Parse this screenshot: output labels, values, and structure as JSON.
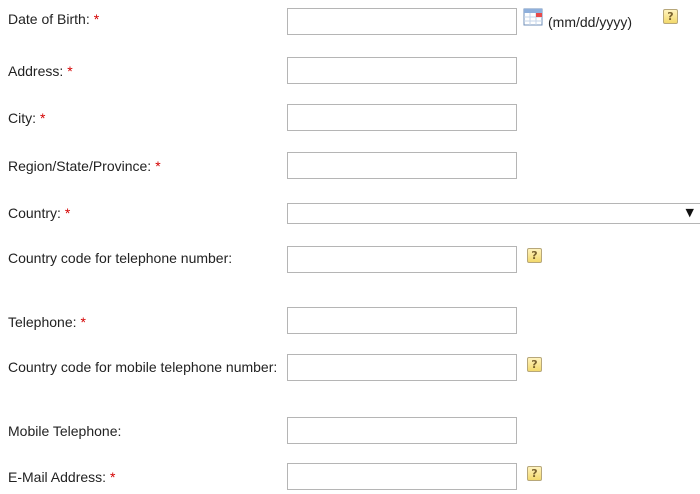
{
  "form": {
    "dob": {
      "label": "Date of Birth:",
      "required_mark": "*",
      "value": "",
      "format_hint": "(mm/dd/yyyy)",
      "help_icon": "?"
    },
    "address": {
      "label": "Address:",
      "required_mark": "*",
      "value": ""
    },
    "city": {
      "label": "City:",
      "required_mark": "*",
      "value": ""
    },
    "region": {
      "label": "Region/State/Province:",
      "required_mark": "*",
      "value": ""
    },
    "country": {
      "label": "Country:",
      "required_mark": "*",
      "selected_value": "",
      "arrow": "▼"
    },
    "country_code_tel": {
      "label": "Country code for telephone number:",
      "value": "",
      "help_icon": "?"
    },
    "telephone": {
      "label": "Telephone:",
      "required_mark": "*",
      "value": ""
    },
    "country_code_mobile": {
      "label": "Country code for mobile telephone number:",
      "value": "",
      "help_icon": "?"
    },
    "mobile": {
      "label": "Mobile Telephone:",
      "value": ""
    },
    "email": {
      "label": "E-Mail Address:",
      "required_mark": "*",
      "value": "",
      "help_icon": "?"
    }
  },
  "icons": {
    "calendar": "calendar-icon",
    "help": "help-icon"
  },
  "colors": {
    "required": "#d40000",
    "border": "#b5b5b5",
    "help_fill": "#f3d96c"
  }
}
